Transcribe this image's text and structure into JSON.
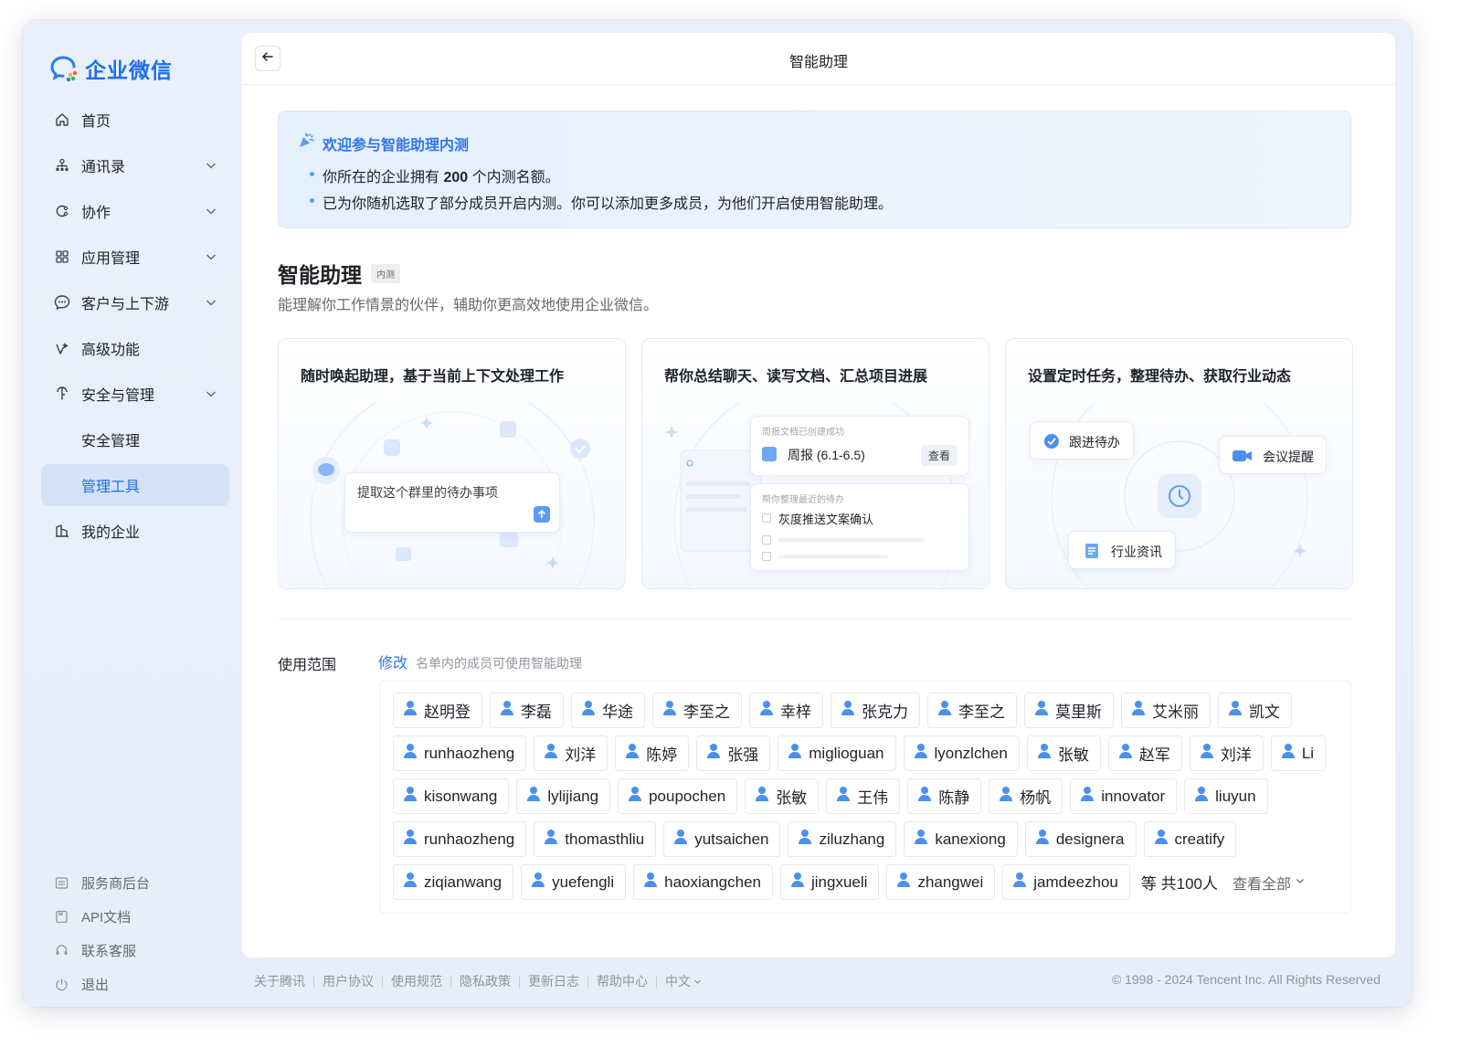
{
  "app": {
    "logo_text": "企业微信",
    "brand_color": "#1f6ee8"
  },
  "sidebar": {
    "items": [
      {
        "label": "首页",
        "icon": "home-icon"
      },
      {
        "label": "通讯录",
        "icon": "org-chart-icon"
      },
      {
        "label": "协作",
        "icon": "collab-icon"
      },
      {
        "label": "应用管理",
        "icon": "apps-grid-icon"
      },
      {
        "label": "客户与上下游",
        "icon": "chat-bubble-icon"
      },
      {
        "label": "高级功能",
        "icon": "advanced-icon"
      },
      {
        "label": "安全与管理",
        "icon": "shield-key-icon"
      },
      {
        "label": "安全管理"
      },
      {
        "label": "管理工具"
      },
      {
        "label": "我的企业",
        "icon": "building-icon"
      }
    ],
    "bottom": [
      {
        "label": "服务商后台",
        "icon": "service-icon"
      },
      {
        "label": "API文档",
        "icon": "doc-icon"
      },
      {
        "label": "联系客服",
        "icon": "headset-icon"
      },
      {
        "label": "退出",
        "icon": "power-icon"
      }
    ]
  },
  "header": {
    "title": "智能助理"
  },
  "banner": {
    "title": "欢迎参与智能助理内测",
    "line1_pre": "你所在的企业拥有 ",
    "line1_num": "200",
    "line1_post": " 个内测名额。",
    "line2": "已为你随机选取了部分成员开启内测。你可以添加更多成员，为他们开启使用智能助理。"
  },
  "section": {
    "title": "智能助理",
    "badge": "内测",
    "desc": "能理解你工作情景的伙伴，辅助你更高效地使用企业微信。"
  },
  "cards": [
    {
      "title": "随时唤起助理，基于当前上下文处理工作",
      "prompt": "提取这个群里的待办事项"
    },
    {
      "title": "帮你总结聊天、读写文档、汇总项目进展",
      "doc_hint": "周报文档已创建成功",
      "doc_name": "周报 (6.1-6.5)",
      "doc_view": "查看",
      "todo_hint": "帮你整理最近的待办",
      "todo_item": "灰度推送文案确认"
    },
    {
      "title": "设置定时任务，整理待办、获取行业动态",
      "chip_todo": "跟进待办",
      "chip_meeting": "会议提醒",
      "chip_news": "行业资讯"
    }
  ],
  "scope": {
    "label": "使用范围",
    "edit": "修改",
    "hint": "名单内的成员可使用智能助理",
    "rows": [
      [
        "赵明登",
        "李磊",
        "华途",
        "李至之",
        "幸梓",
        "张克力",
        "李至之",
        "莫里斯",
        "艾米丽",
        "凯文"
      ],
      [
        "runhaozheng",
        "刘洋",
        "陈婷",
        "张强",
        "miglioguan",
        "lyonzlchen",
        "张敏",
        "赵军",
        "刘洋",
        "Li"
      ],
      [
        "kisonwang",
        "lylijiang",
        "poupochen",
        "张敏",
        "王伟",
        "陈静",
        "杨帆",
        "innovator",
        "liuyun"
      ],
      [
        "runhaozheng",
        "thomasthliu",
        "yutsaichen",
        "ziluzhang",
        "kanexiong",
        "designera",
        "creatify"
      ],
      [
        "ziqianwang",
        "yuefengli",
        "haoxiangchen",
        "jingxueli",
        "zhangwei",
        "jamdeezhou"
      ]
    ],
    "total": "等 共100人",
    "view_all": "查看全部"
  },
  "footer": {
    "links": [
      "关于腾讯",
      "用户协议",
      "使用规范",
      "隐私政策",
      "更新日志",
      "帮助中心",
      "中文"
    ],
    "copyright": "© 1998 - 2024 Tencent Inc. All Rights Reserved"
  }
}
